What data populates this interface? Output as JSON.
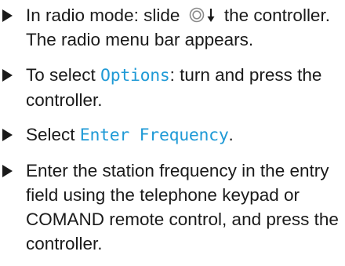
{
  "steps": [
    {
      "line1_before": "In radio mode: slide ",
      "controller_icon": "controller-slide-down-icon",
      "line1_after": " the controller.",
      "line2": "The radio menu bar appears."
    },
    {
      "before": "To select ",
      "menu_item": "Options",
      "after": ": turn and press the controller."
    },
    {
      "before": "Select ",
      "menu_item": "Enter Frequency",
      "after": "."
    },
    {
      "text": "Enter the station frequency in the entry field using the telephone keypad or COMAND remote control, and press the controller."
    }
  ],
  "colors": {
    "text": "#1a1a1a",
    "ui_item": "#1f9ad6",
    "icon": "#8a8a8a"
  }
}
